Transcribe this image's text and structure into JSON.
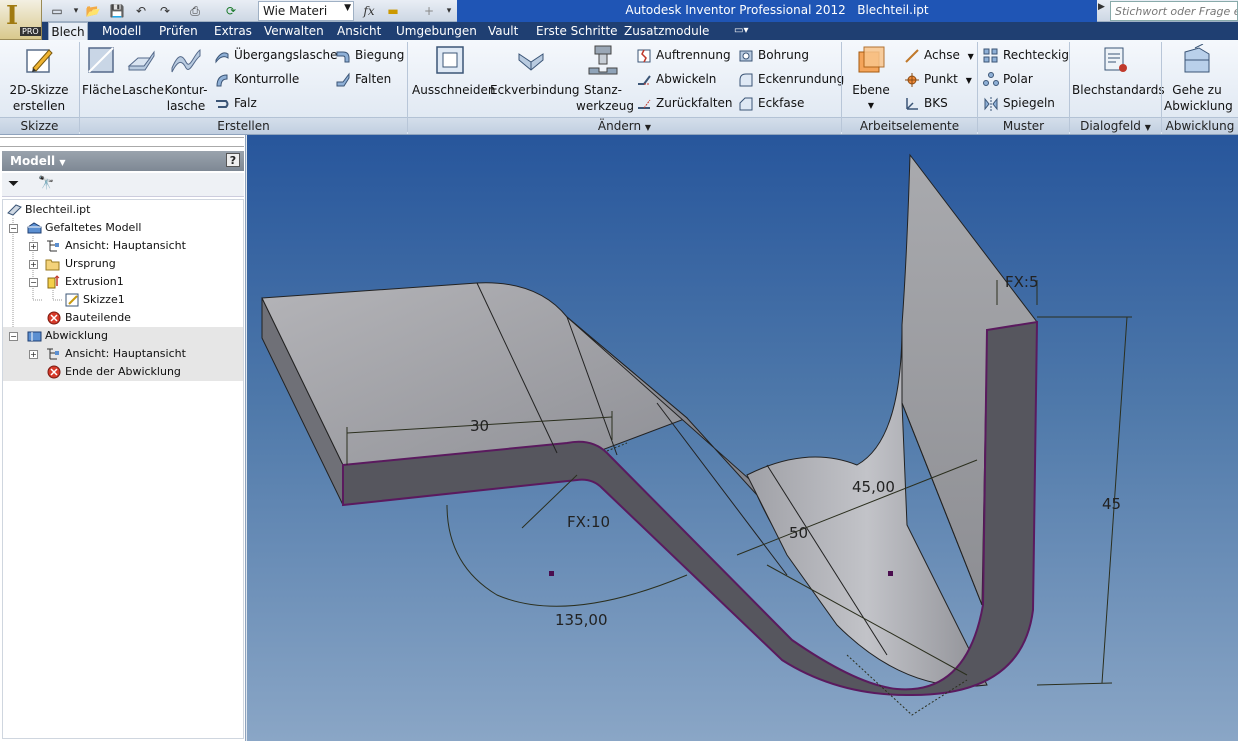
{
  "app": {
    "title": "Autodesk Inventor Professional 2012",
    "document": "Blechteil.ipt",
    "badge": "PRO",
    "material_value": "Wie Materi",
    "search_placeholder": "Stichwort oder Frage einge",
    "colors": {
      "title_bar": "#1f55b5",
      "tab_row": "#1f3f72",
      "viewport_top": "#27569c",
      "viewport_bottom": "#8aa6c6",
      "edge_highlight": "#5a1a5e"
    }
  },
  "tabs": [
    "Blech",
    "Modell",
    "Prüfen",
    "Extras",
    "Verwalten",
    "Ansicht",
    "Umgebungen",
    "Vault",
    "Erste Schritte",
    "Zusatzmodule"
  ],
  "ribbon": {
    "skizze": {
      "label": "Skizze",
      "button_line1": "2D-Skizze",
      "button_line2": "erstellen"
    },
    "erstellen": {
      "label": "Erstellen",
      "flaeche": "Fläche",
      "lasche": "Lasche",
      "konturlasche_line1": "Kontur-",
      "konturlasche_line2": "lasche",
      "uebergangslasche": "Übergangslasche",
      "konturrolle": "Konturrolle",
      "falz": "Falz",
      "biegung": "Biegung",
      "falten": "Falten"
    },
    "aendern": {
      "label": "Ändern",
      "ausschneiden": "Ausschneiden",
      "eckverbindung": "Eckverbindung",
      "stanzwerkzeug_line1": "Stanz-",
      "stanzwerkzeug_line2": "werkzeug",
      "auftrennung": "Auftrennung",
      "abwickeln": "Abwickeln",
      "zurueckfalten": "Zurückfalten",
      "bohrung": "Bohrung",
      "eckenrundung": "Eckenrundung",
      "eckfase": "Eckfase"
    },
    "arbeitselemente": {
      "label": "Arbeitselemente",
      "ebene": "Ebene",
      "achse": "Achse",
      "punkt": "Punkt",
      "bks": "BKS"
    },
    "muster": {
      "label": "Muster",
      "rechteckig": "Rechteckig",
      "polar": "Polar",
      "spiegeln": "Spiegeln"
    },
    "dialogfeld": {
      "label": "Dialogfeld",
      "blechstandards": "Blechstandards"
    },
    "abwicklung": {
      "label": "Abwicklung",
      "gehe_zu_line1": "Gehe zu",
      "gehe_zu_line2": "Abwicklung"
    }
  },
  "browser": {
    "header": "Modell",
    "tree": [
      {
        "label": "Blechteil.ipt",
        "icon": "part-icon"
      },
      {
        "label": "Gefaltetes Modell",
        "icon": "folded-model-icon"
      },
      {
        "label": "Ansicht: Hauptansicht",
        "icon": "view-icon"
      },
      {
        "label": "Ursprung",
        "icon": "folder-icon"
      },
      {
        "label": "Extrusion1",
        "icon": "extrusion-icon"
      },
      {
        "label": "Skizze1",
        "icon": "sketch-icon"
      },
      {
        "label": "Bauteilende",
        "icon": "end-of-part-icon"
      },
      {
        "label": "Abwicklung",
        "icon": "flat-pattern-icon"
      },
      {
        "label": "Ansicht: Hauptansicht",
        "icon": "view-icon"
      },
      {
        "label": "Ende der Abwicklung",
        "icon": "end-of-part-icon"
      }
    ]
  },
  "viewport": {
    "dimensions": [
      "30",
      "FX:10",
      "135,00",
      "50",
      "45,00",
      "45",
      "FX:5"
    ]
  }
}
